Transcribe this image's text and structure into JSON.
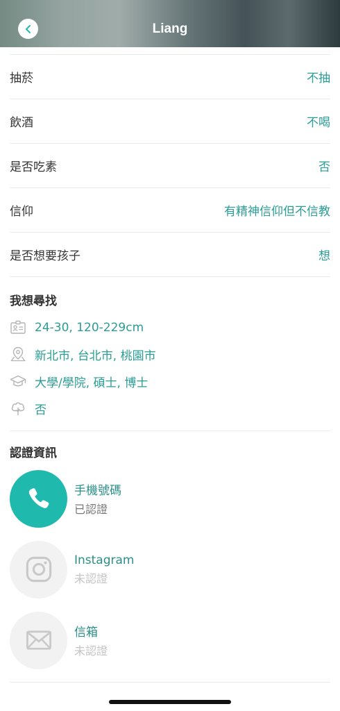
{
  "header": {
    "title": "Liang",
    "back_icon": "chevron-left-icon"
  },
  "details": [
    {
      "label": "抽菸",
      "value": "不抽"
    },
    {
      "label": "飲酒",
      "value": "不喝"
    },
    {
      "label": "是否吃素",
      "value": "否"
    },
    {
      "label": "信仰",
      "value": "有精神信仰但不信教"
    },
    {
      "label": "是否想要孩子",
      "value": "想"
    }
  ],
  "looking_for": {
    "title": "我想尋找",
    "items": [
      {
        "icon": "id-card-icon",
        "text": "24-30, 120-229cm"
      },
      {
        "icon": "location-pin-icon",
        "text": "新北市, 台北市, 桃園市"
      },
      {
        "icon": "graduation-cap-icon",
        "text": "大學/學院, 碩士, 博士"
      },
      {
        "icon": "tree-icon",
        "text": "否"
      }
    ]
  },
  "verification": {
    "title": "認證資訊",
    "items": [
      {
        "icon": "phone-icon",
        "name": "手機號碼",
        "status": "已認證",
        "verified": true
      },
      {
        "icon": "instagram-icon",
        "name": "Instagram",
        "status": "未認證",
        "verified": false
      },
      {
        "icon": "mail-icon",
        "name": "信箱",
        "status": "未認證",
        "verified": false
      }
    ]
  },
  "colors": {
    "accent": "#2a9d95",
    "verified_circle": "#1fb9ad",
    "unverified_circle": "#f2f2f2"
  }
}
